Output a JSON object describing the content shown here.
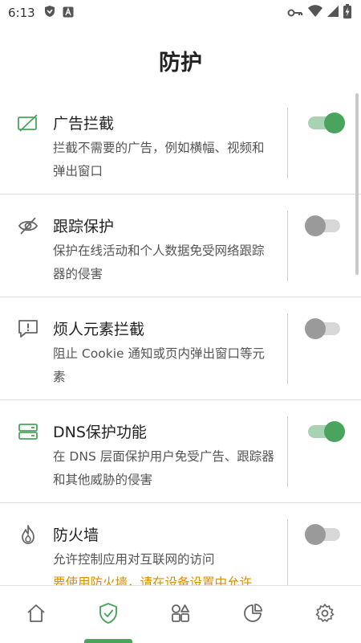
{
  "status_bar": {
    "time": "6:13",
    "left_icons": [
      "shield-icon",
      "app-a-icon"
    ],
    "right_icons": [
      "vpn-key-icon",
      "wifi-icon",
      "cell-signal-icon",
      "battery-charging-icon"
    ]
  },
  "header": {
    "title": "防护"
  },
  "rows": [
    {
      "title": "广告拦截",
      "desc": "拦截不需要的广告，例如横幅、视频和弹出窗口",
      "icon": "ad-block-icon",
      "enabled": true
    },
    {
      "title": "跟踪保护",
      "desc": "保护在线活动和个人数据免受网络跟踪器的侵害",
      "icon": "eye-off-icon",
      "enabled": false
    },
    {
      "title": "烦人元素拦截",
      "desc": "阻止 Cookie 通知或页内弹出窗口等元素",
      "icon": "alert-message-icon",
      "enabled": false
    },
    {
      "title": "DNS保护功能",
      "desc": "在 DNS 层面保护用户免受广告、跟踪器和其他威胁的侵害",
      "icon": "dns-server-icon",
      "enabled": true
    },
    {
      "title": "防火墙",
      "desc": "允许控制应用对互联网的访问",
      "warning": "要使用防火墙，请在设备设置中允许",
      "icon": "flame-icon",
      "enabled": false
    }
  ],
  "bottom_nav": {
    "items": [
      {
        "icon": "home-icon",
        "active": false
      },
      {
        "icon": "shield-check-icon",
        "active": true
      },
      {
        "icon": "apps-grid-icon",
        "active": false
      },
      {
        "icon": "pie-chart-icon",
        "active": false
      },
      {
        "icon": "settings-gear-icon",
        "active": false
      }
    ]
  },
  "colors": {
    "accent": "#4aa45e",
    "accent_light": "#a8d3b2",
    "warning": "#d99000",
    "toggle_off": "#9a9a9a"
  }
}
